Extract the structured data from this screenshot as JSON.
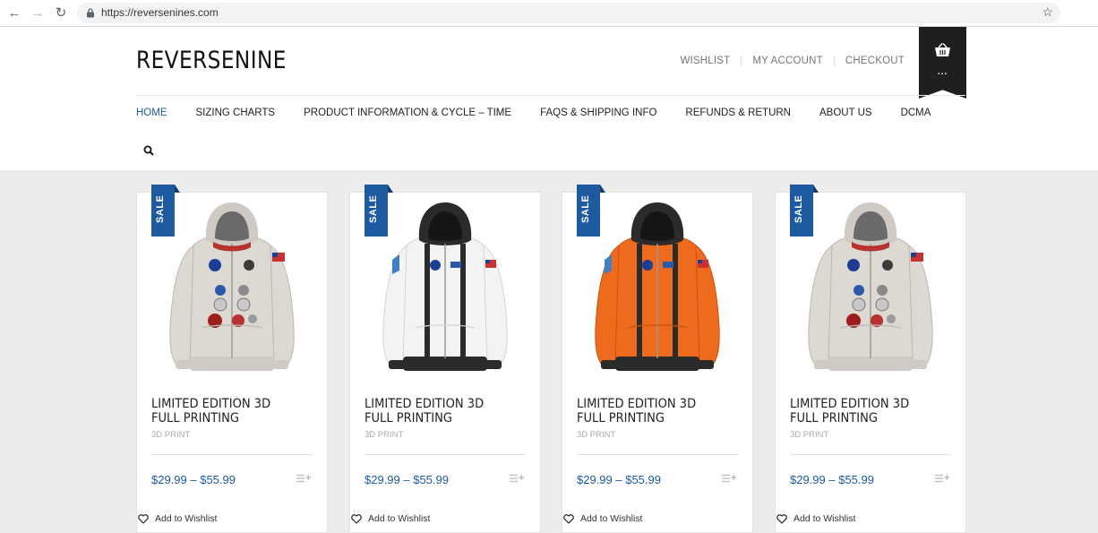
{
  "browser": {
    "url": "https://reversenines.com",
    "icons": [
      "back-arrow-icon",
      "forward-arrow-icon",
      "reload-icon",
      "lock-icon",
      "star-icon"
    ]
  },
  "header": {
    "logo": "REVERSENINE",
    "top_links": [
      "WISHLIST",
      "MY ACCOUNT",
      "CHECKOUT"
    ],
    "cart_label": "..."
  },
  "nav": {
    "items": [
      {
        "label": "HOME",
        "active": true
      },
      {
        "label": "SIZING CHARTS",
        "active": false
      },
      {
        "label": "PRODUCT INFORMATION & CYCLE – TIME",
        "active": false
      },
      {
        "label": "FAQS & SHIPPING INFO",
        "active": false
      },
      {
        "label": "REFUNDS & RETURN",
        "active": false
      },
      {
        "label": "ABOUT US",
        "active": false
      },
      {
        "label": "DCMA",
        "active": false
      }
    ]
  },
  "colors": {
    "accent": "#1e5aa0",
    "products_background": "#ececec",
    "cart_ribbon": "#1f1f1f"
  },
  "products": [
    {
      "badge": "SALE",
      "title": "LIMITED EDITION 3D FULL PRINTING",
      "category": "3D PRINT",
      "price": "$29.99 – $55.99",
      "wishlist": "Add to Wishlist",
      "variant": "white-apollo"
    },
    {
      "badge": "SALE",
      "title": "LIMITED EDITION 3D FULL PRINTING",
      "category": "3D PRINT",
      "price": "$29.99 – $55.99",
      "wishlist": "Add to Wishlist",
      "variant": "white-black-straps"
    },
    {
      "badge": "SALE",
      "title": "LIMITED EDITION 3D FULL PRINTING",
      "category": "3D PRINT",
      "price": "$29.99 – $55.99",
      "wishlist": "Add to Wishlist",
      "variant": "orange-black-straps"
    },
    {
      "badge": "SALE",
      "title": "LIMITED EDITION 3D FULL PRINTING",
      "category": "3D PRINT",
      "price": "$29.99 – $55.99",
      "wishlist": "Add to Wishlist",
      "variant": "white-apollo"
    }
  ]
}
